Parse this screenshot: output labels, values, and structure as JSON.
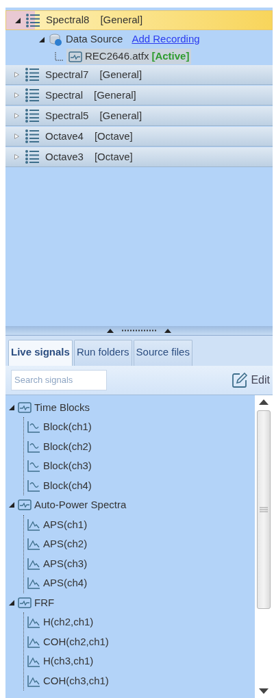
{
  "configurations": [
    {
      "name": "Spectral8",
      "type": "[General]",
      "selected": true,
      "expanded": true,
      "data_source": {
        "label": "Data Source",
        "link": "Add Recording",
        "expanded": true,
        "file": {
          "name": "REC2646.atfx",
          "status": "[Active]"
        }
      }
    },
    {
      "name": "Spectral7",
      "type": "[General]",
      "selected": false,
      "expanded": false
    },
    {
      "name": "Spectral",
      "type": "[General]",
      "selected": false,
      "expanded": false
    },
    {
      "name": "Spectral5",
      "type": "[General]",
      "selected": false,
      "expanded": false
    },
    {
      "name": "Octave4",
      "type": "[Octave]",
      "selected": false,
      "expanded": false
    },
    {
      "name": "Octave3",
      "type": "[Octave]",
      "selected": false,
      "expanded": false
    }
  ],
  "tabs": [
    {
      "label": "Live signals",
      "selected": true
    },
    {
      "label": "Run folders",
      "selected": false
    },
    {
      "label": "Source files",
      "selected": false
    }
  ],
  "search": {
    "placeholder": "Search signals"
  },
  "edit_button": "Edit",
  "signal_tree": [
    {
      "label": "Time Blocks",
      "expanded": true,
      "children": [
        {
          "label": "Block(ch1)",
          "kind": "time"
        },
        {
          "label": "Block(ch2)",
          "kind": "time"
        },
        {
          "label": "Block(ch3)",
          "kind": "time"
        },
        {
          "label": "Block(ch4)",
          "kind": "time"
        }
      ]
    },
    {
      "label": "Auto-Power Spectra",
      "expanded": true,
      "children": [
        {
          "label": "APS(ch1)",
          "kind": "spectrum"
        },
        {
          "label": "APS(ch2)",
          "kind": "spectrum"
        },
        {
          "label": "APS(ch3)",
          "kind": "spectrum"
        },
        {
          "label": "APS(ch4)",
          "kind": "spectrum"
        }
      ]
    },
    {
      "label": "FRF",
      "expanded": true,
      "children": [
        {
          "label": "H(ch2,ch1)",
          "kind": "spectrum"
        },
        {
          "label": "COH(ch2,ch1)",
          "kind": "spectrum"
        },
        {
          "label": "H(ch3,ch1)",
          "kind": "spectrum"
        },
        {
          "label": "COH(ch3,ch1)",
          "kind": "spectrum"
        }
      ]
    }
  ]
}
